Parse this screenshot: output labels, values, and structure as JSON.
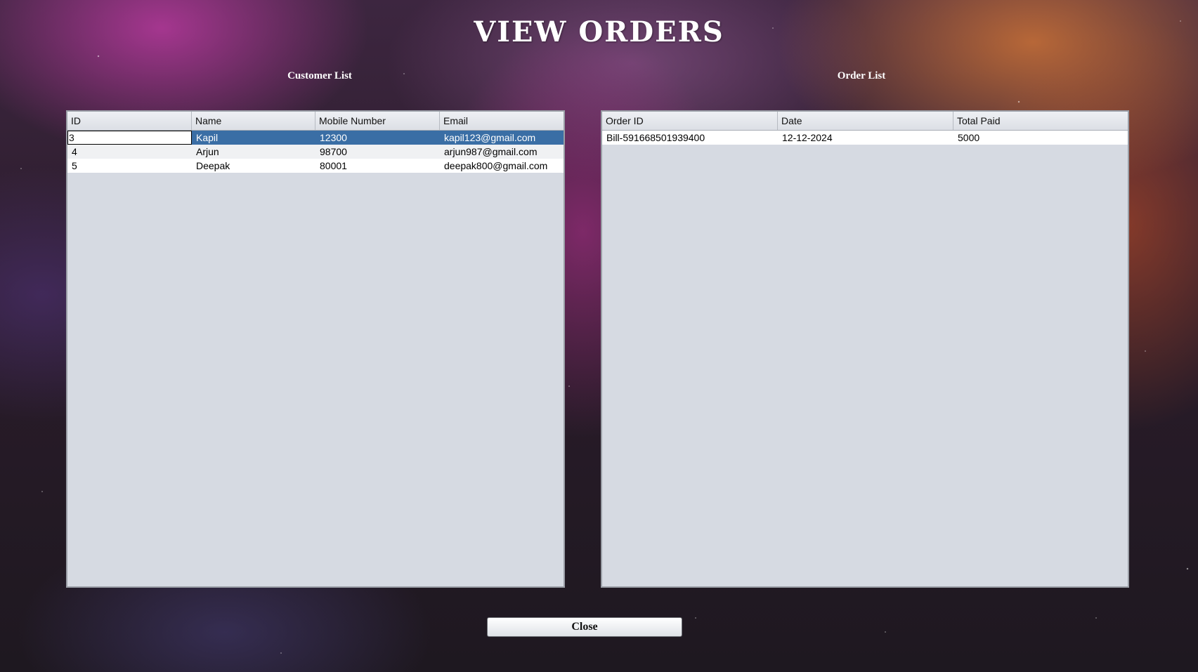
{
  "window": {
    "title": "VIEW ORDERS"
  },
  "customers": {
    "label": "Customer List",
    "columns": [
      "ID",
      "Name",
      "Mobile Number",
      "Email"
    ],
    "rows": [
      [
        "3",
        "Kapil",
        "12300",
        "kapil123@gmail.com"
      ],
      [
        "4",
        "Arjun",
        "98700",
        "arjun987@gmail.com"
      ],
      [
        "5",
        "Deepak",
        "80001",
        "deepak800@gmail.com"
      ]
    ],
    "selected_row": 0
  },
  "orders": {
    "label": "Order List",
    "columns": [
      "Order ID",
      "Date",
      "Total Paid"
    ],
    "rows": [
      [
        "Bill-591668501939400",
        "12-12-2024",
        "5000"
      ]
    ]
  },
  "actions": {
    "close_label": "Close"
  },
  "colors": {
    "selection": "#3a6ea5",
    "table_background": "#d6dae2"
  }
}
